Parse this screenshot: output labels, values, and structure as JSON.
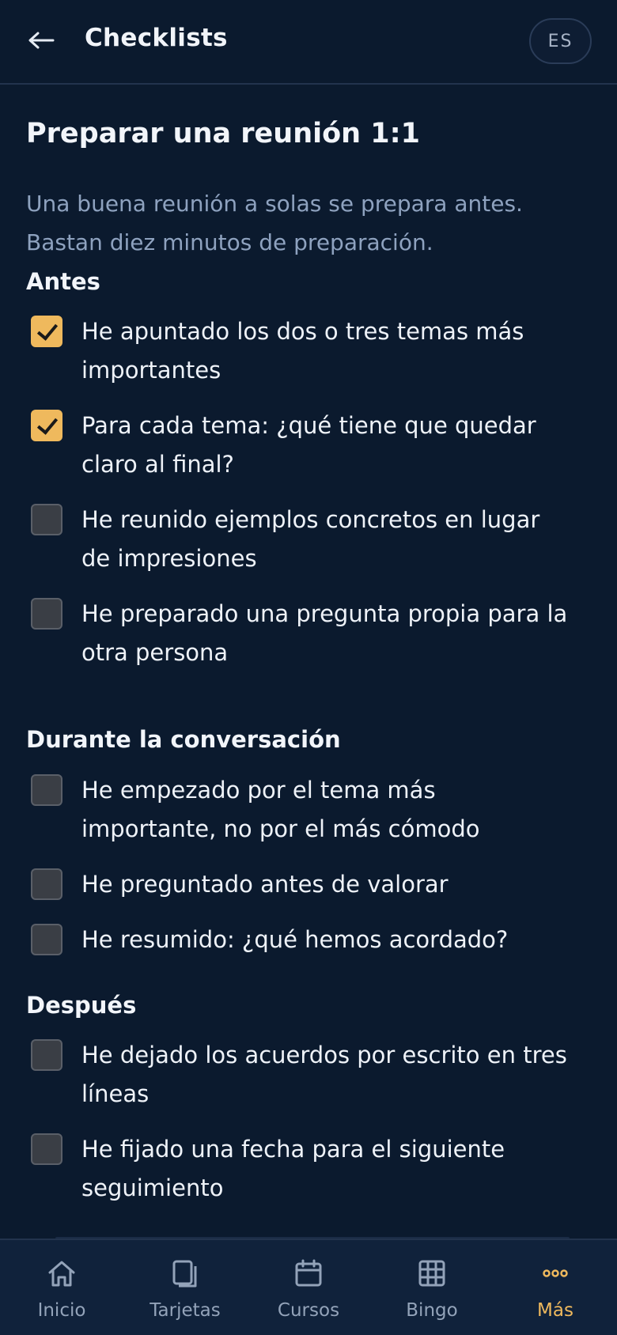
{
  "header": {
    "back_icon": "arrow-left-icon",
    "title": "Checklists",
    "lang": "ES"
  },
  "page": {
    "title": "Preparar una reunión 1:1",
    "intro_line1": "Una buena reunión a solas se prepara antes.",
    "intro_line2": "Bastan diez minutos de preparación."
  },
  "sections": [
    {
      "heading": "Antes",
      "items": [
        {
          "line1": "He apuntado los dos o tres temas más",
          "line2": "importantes",
          "checked": true
        },
        {
          "line1": "Para cada tema: ¿qué tiene que quedar",
          "line2": "claro al final?",
          "checked": true
        },
        {
          "line1": "He reunido ejemplos concretos en lugar",
          "line2": "de impresiones",
          "checked": false
        },
        {
          "line1": "He preparado una pregunta propia para la",
          "line2": "otra persona",
          "checked": false
        }
      ]
    },
    {
      "heading": "Durante la conversación",
      "items": [
        {
          "line1": "He empezado por el tema más",
          "line2": "importante, no por el más cómodo",
          "checked": false
        },
        {
          "line1": "He preguntado antes de valorar",
          "line2": "",
          "checked": false
        },
        {
          "line1": "He resumido: ¿qué hemos acordado?",
          "line2": "",
          "checked": false
        }
      ]
    },
    {
      "heading": "Después",
      "items": [
        {
          "line1": "He dejado los acuerdos por escrito en tres",
          "line2": "líneas",
          "checked": false
        },
        {
          "line1": "He fijado una fecha para el siguiente",
          "line2": "seguimiento",
          "checked": false
        }
      ]
    }
  ],
  "nav": [
    {
      "label": "Inicio",
      "icon": "home-icon",
      "active": false
    },
    {
      "label": "Tarjetas",
      "icon": "cards-icon",
      "active": false
    },
    {
      "label": "Cursos",
      "icon": "calendar-icon",
      "active": false
    },
    {
      "label": "Bingo",
      "icon": "grid-icon",
      "active": false
    },
    {
      "label": "Más",
      "icon": "more-dots-icon",
      "active": true
    }
  ],
  "colors": {
    "background": "#0b1a2e",
    "accent": "#efb95d",
    "muted_text": "#8ea2bf",
    "nav_background": "#10223b"
  }
}
